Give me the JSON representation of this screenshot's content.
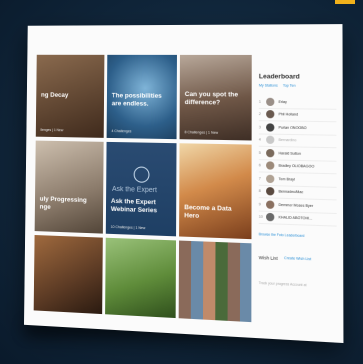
{
  "tiles": [
    {
      "caption": "ng Decay",
      "meta": "llenges | 1 New",
      "bg": "#6a4a36"
    },
    {
      "caption": "The possibilities are endless.",
      "meta": "4 Challenges",
      "bg": "#2d5f8a"
    },
    {
      "caption": "Can you spot the difference?",
      "meta": "8 Challenges | 1 New",
      "bg": "#7b6556"
    },
    {
      "caption": "uly Progressing nge",
      "meta": "",
      "bg": "#8a7a6a"
    },
    {
      "caption": "Ask the Expert Webinar Series",
      "meta": "10 Challenges | 1 New",
      "bg": "#1e3f64"
    },
    {
      "caption": "Become a Data Hero",
      "meta": "",
      "bg": "#b45d2d"
    },
    {
      "caption": "",
      "meta": "",
      "bg": "#5b3a24"
    },
    {
      "caption": "",
      "meta": "",
      "bg": "#5f8c3a"
    },
    {
      "caption": "",
      "meta": "",
      "bg": "#3e5d7a"
    }
  ],
  "ask_expert_overlay": "Ask the Expert",
  "leaderboard": {
    "title": "Leaderboard",
    "tabs": [
      "My Stations",
      "Top Ten"
    ],
    "rows": [
      {
        "rank": "1",
        "name": "Erlay"
      },
      {
        "rank": "2",
        "name": "Phil Holland"
      },
      {
        "rank": "3",
        "name": "Purlan ONOOBO"
      },
      {
        "rank": "4",
        "name": "Bernardino"
      },
      {
        "rank": "5",
        "name": "Harald Sutton"
      },
      {
        "rank": "6",
        "name": "Bradley OLIOBAGOO"
      },
      {
        "rank": "7",
        "name": "Tom Brayl"
      },
      {
        "rank": "8",
        "name": "Bennadeo/Mac"
      },
      {
        "rank": "9",
        "name": "Demmor Moses Byer"
      },
      {
        "rank": "10",
        "name": "KHALID ABOTOHI..."
      }
    ],
    "link": "Browse the Foto Leaderboard",
    "wish_list": "Wish List",
    "wish_add": "Create Wish List",
    "footer": "Track your progress Account at"
  },
  "colors": {
    "background": "#0e2236",
    "accent": "#f2b21b",
    "link": "#2a8fd6"
  }
}
